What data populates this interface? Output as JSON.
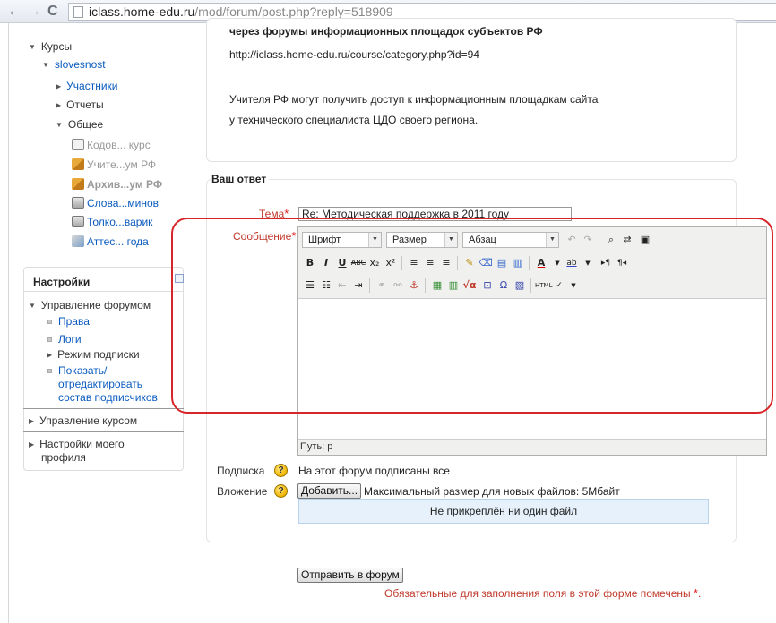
{
  "browser": {
    "url_domain": "iclass.home-edu.ru",
    "url_path": "/mod/forum/post.php?reply=518909"
  },
  "sidebar": {
    "nav": {
      "courses": "Курсы",
      "course": "slovesnost",
      "participants": "Участники",
      "reports": "Отчеты",
      "general": "Общее",
      "items": [
        {
          "label": "Кодов... курс",
          "icon": "document-icon"
        },
        {
          "label": "Учите...ум РФ",
          "icon": "forum-icon"
        },
        {
          "label": "Архив...ум РФ",
          "icon": "forum-icon"
        },
        {
          "label": "Слова...минов",
          "icon": "glossary-icon"
        },
        {
          "label": "Толко...варик",
          "icon": "glossary-icon"
        },
        {
          "label": "Аттес... года",
          "icon": "quiz-icon"
        }
      ]
    },
    "settings": {
      "title": "Настройки",
      "forum_admin": "Управление форумом",
      "rights": "Права",
      "logs": "Логи",
      "subscription_mode": "Режим подписки",
      "show_edit_1": "Показать/",
      "show_edit_2": "отредактировать",
      "show_edit_3": "состав подписчиков",
      "course_admin": "Управление курсом",
      "profile_1": "Настройки моего",
      "profile_2": "профиля"
    }
  },
  "post": {
    "line1": "через форумы информационных площадок субъектов РФ",
    "link": "http://iclass.home-edu.ru/course/category.php?id=94",
    "line2": "Учителя РФ могут получить доступ к информационным площадкам сайта",
    "line3": "у технического специалиста ЦДО своего региона."
  },
  "form": {
    "legend": "Ваш ответ",
    "subject_label": "Тема",
    "subject_value": "Re: Методическая поддержка в 2011 году",
    "message_label": "Сообщение",
    "required_mark": "*",
    "editor": {
      "font_select": "Шрифт",
      "size_select": "Размер",
      "format_select": "Абзац",
      "path": "Путь: p"
    },
    "subscription_label": "Подписка",
    "subscription_value": "На этот форум подписаны все",
    "attachment_label": "Вложение",
    "add_button": "Добавить...",
    "max_size": "Максимальный размер для новых файлов: 5Мбайт",
    "no_files": "Не прикреплён ни один файл",
    "submit": "Отправить в форум",
    "required_note": "Обязательные для заполнения поля в этой форме помечены",
    "help_glyph": "?"
  },
  "colors": {
    "link": "#0a5bbf",
    "required": "#e02020",
    "annotation": "#d7262a"
  }
}
